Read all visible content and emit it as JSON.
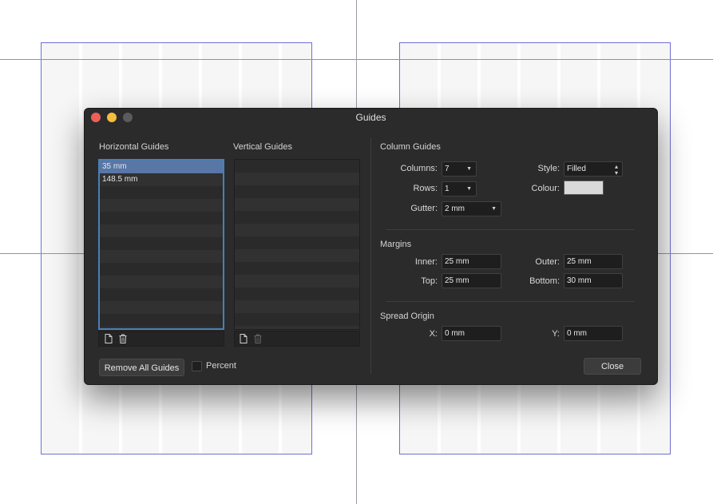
{
  "dialog": {
    "title": "Guides"
  },
  "horizontal_guides": {
    "label": "Horizontal Guides",
    "items": [
      "35 mm",
      "148.5 mm"
    ],
    "selected_index": 0
  },
  "vertical_guides": {
    "label": "Vertical Guides",
    "items": []
  },
  "footer": {
    "remove_all_label": "Remove All Guides",
    "percent_label": "Percent",
    "close_label": "Close"
  },
  "column_guides": {
    "label": "Column Guides",
    "columns_label": "Columns:",
    "columns": "7",
    "rows_label": "Rows:",
    "rows": "1",
    "gutter_label": "Gutter:",
    "gutter": "2 mm",
    "style_label": "Style:",
    "style": "Filled",
    "colour_label": "Colour:",
    "colour": "#d9d9d9"
  },
  "margins": {
    "label": "Margins",
    "inner_label": "Inner:",
    "inner": "25 mm",
    "outer_label": "Outer:",
    "outer": "25 mm",
    "top_label": "Top:",
    "top": "25 mm",
    "bottom_label": "Bottom:",
    "bottom": "30 mm"
  },
  "spread_origin": {
    "label": "Spread Origin",
    "x_label": "X:",
    "x": "0 mm",
    "y_label": "Y:",
    "y": "0 mm"
  },
  "icons": {
    "add": "document-add-icon",
    "delete": "trash-icon"
  }
}
